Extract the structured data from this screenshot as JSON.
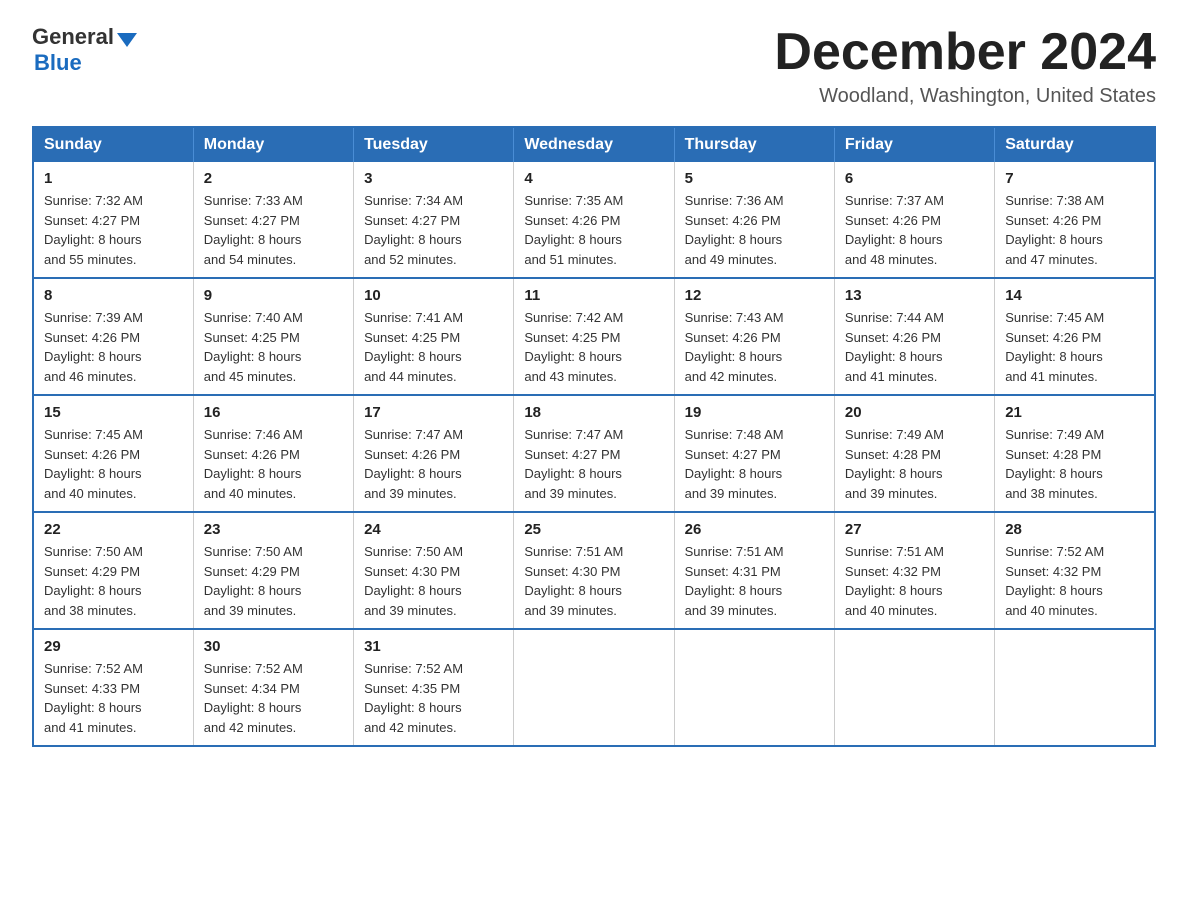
{
  "header": {
    "logo_general": "General",
    "logo_blue": "Blue",
    "title": "December 2024",
    "subtitle": "Woodland, Washington, United States"
  },
  "days_of_week": [
    "Sunday",
    "Monday",
    "Tuesday",
    "Wednesday",
    "Thursday",
    "Friday",
    "Saturday"
  ],
  "weeks": [
    [
      {
        "day": "1",
        "sunrise": "Sunrise: 7:32 AM",
        "sunset": "Sunset: 4:27 PM",
        "daylight": "Daylight: 8 hours",
        "daylight2": "and 55 minutes."
      },
      {
        "day": "2",
        "sunrise": "Sunrise: 7:33 AM",
        "sunset": "Sunset: 4:27 PM",
        "daylight": "Daylight: 8 hours",
        "daylight2": "and 54 minutes."
      },
      {
        "day": "3",
        "sunrise": "Sunrise: 7:34 AM",
        "sunset": "Sunset: 4:27 PM",
        "daylight": "Daylight: 8 hours",
        "daylight2": "and 52 minutes."
      },
      {
        "day": "4",
        "sunrise": "Sunrise: 7:35 AM",
        "sunset": "Sunset: 4:26 PM",
        "daylight": "Daylight: 8 hours",
        "daylight2": "and 51 minutes."
      },
      {
        "day": "5",
        "sunrise": "Sunrise: 7:36 AM",
        "sunset": "Sunset: 4:26 PM",
        "daylight": "Daylight: 8 hours",
        "daylight2": "and 49 minutes."
      },
      {
        "day": "6",
        "sunrise": "Sunrise: 7:37 AM",
        "sunset": "Sunset: 4:26 PM",
        "daylight": "Daylight: 8 hours",
        "daylight2": "and 48 minutes."
      },
      {
        "day": "7",
        "sunrise": "Sunrise: 7:38 AM",
        "sunset": "Sunset: 4:26 PM",
        "daylight": "Daylight: 8 hours",
        "daylight2": "and 47 minutes."
      }
    ],
    [
      {
        "day": "8",
        "sunrise": "Sunrise: 7:39 AM",
        "sunset": "Sunset: 4:26 PM",
        "daylight": "Daylight: 8 hours",
        "daylight2": "and 46 minutes."
      },
      {
        "day": "9",
        "sunrise": "Sunrise: 7:40 AM",
        "sunset": "Sunset: 4:25 PM",
        "daylight": "Daylight: 8 hours",
        "daylight2": "and 45 minutes."
      },
      {
        "day": "10",
        "sunrise": "Sunrise: 7:41 AM",
        "sunset": "Sunset: 4:25 PM",
        "daylight": "Daylight: 8 hours",
        "daylight2": "and 44 minutes."
      },
      {
        "day": "11",
        "sunrise": "Sunrise: 7:42 AM",
        "sunset": "Sunset: 4:25 PM",
        "daylight": "Daylight: 8 hours",
        "daylight2": "and 43 minutes."
      },
      {
        "day": "12",
        "sunrise": "Sunrise: 7:43 AM",
        "sunset": "Sunset: 4:26 PM",
        "daylight": "Daylight: 8 hours",
        "daylight2": "and 42 minutes."
      },
      {
        "day": "13",
        "sunrise": "Sunrise: 7:44 AM",
        "sunset": "Sunset: 4:26 PM",
        "daylight": "Daylight: 8 hours",
        "daylight2": "and 41 minutes."
      },
      {
        "day": "14",
        "sunrise": "Sunrise: 7:45 AM",
        "sunset": "Sunset: 4:26 PM",
        "daylight": "Daylight: 8 hours",
        "daylight2": "and 41 minutes."
      }
    ],
    [
      {
        "day": "15",
        "sunrise": "Sunrise: 7:45 AM",
        "sunset": "Sunset: 4:26 PM",
        "daylight": "Daylight: 8 hours",
        "daylight2": "and 40 minutes."
      },
      {
        "day": "16",
        "sunrise": "Sunrise: 7:46 AM",
        "sunset": "Sunset: 4:26 PM",
        "daylight": "Daylight: 8 hours",
        "daylight2": "and 40 minutes."
      },
      {
        "day": "17",
        "sunrise": "Sunrise: 7:47 AM",
        "sunset": "Sunset: 4:26 PM",
        "daylight": "Daylight: 8 hours",
        "daylight2": "and 39 minutes."
      },
      {
        "day": "18",
        "sunrise": "Sunrise: 7:47 AM",
        "sunset": "Sunset: 4:27 PM",
        "daylight": "Daylight: 8 hours",
        "daylight2": "and 39 minutes."
      },
      {
        "day": "19",
        "sunrise": "Sunrise: 7:48 AM",
        "sunset": "Sunset: 4:27 PM",
        "daylight": "Daylight: 8 hours",
        "daylight2": "and 39 minutes."
      },
      {
        "day": "20",
        "sunrise": "Sunrise: 7:49 AM",
        "sunset": "Sunset: 4:28 PM",
        "daylight": "Daylight: 8 hours",
        "daylight2": "and 39 minutes."
      },
      {
        "day": "21",
        "sunrise": "Sunrise: 7:49 AM",
        "sunset": "Sunset: 4:28 PM",
        "daylight": "Daylight: 8 hours",
        "daylight2": "and 38 minutes."
      }
    ],
    [
      {
        "day": "22",
        "sunrise": "Sunrise: 7:50 AM",
        "sunset": "Sunset: 4:29 PM",
        "daylight": "Daylight: 8 hours",
        "daylight2": "and 38 minutes."
      },
      {
        "day": "23",
        "sunrise": "Sunrise: 7:50 AM",
        "sunset": "Sunset: 4:29 PM",
        "daylight": "Daylight: 8 hours",
        "daylight2": "and 39 minutes."
      },
      {
        "day": "24",
        "sunrise": "Sunrise: 7:50 AM",
        "sunset": "Sunset: 4:30 PM",
        "daylight": "Daylight: 8 hours",
        "daylight2": "and 39 minutes."
      },
      {
        "day": "25",
        "sunrise": "Sunrise: 7:51 AM",
        "sunset": "Sunset: 4:30 PM",
        "daylight": "Daylight: 8 hours",
        "daylight2": "and 39 minutes."
      },
      {
        "day": "26",
        "sunrise": "Sunrise: 7:51 AM",
        "sunset": "Sunset: 4:31 PM",
        "daylight": "Daylight: 8 hours",
        "daylight2": "and 39 minutes."
      },
      {
        "day": "27",
        "sunrise": "Sunrise: 7:51 AM",
        "sunset": "Sunset: 4:32 PM",
        "daylight": "Daylight: 8 hours",
        "daylight2": "and 40 minutes."
      },
      {
        "day": "28",
        "sunrise": "Sunrise: 7:52 AM",
        "sunset": "Sunset: 4:32 PM",
        "daylight": "Daylight: 8 hours",
        "daylight2": "and 40 minutes."
      }
    ],
    [
      {
        "day": "29",
        "sunrise": "Sunrise: 7:52 AM",
        "sunset": "Sunset: 4:33 PM",
        "daylight": "Daylight: 8 hours",
        "daylight2": "and 41 minutes."
      },
      {
        "day": "30",
        "sunrise": "Sunrise: 7:52 AM",
        "sunset": "Sunset: 4:34 PM",
        "daylight": "Daylight: 8 hours",
        "daylight2": "and 42 minutes."
      },
      {
        "day": "31",
        "sunrise": "Sunrise: 7:52 AM",
        "sunset": "Sunset: 4:35 PM",
        "daylight": "Daylight: 8 hours",
        "daylight2": "and 42 minutes."
      },
      {
        "day": "",
        "empty": true
      },
      {
        "day": "",
        "empty": true
      },
      {
        "day": "",
        "empty": true
      },
      {
        "day": "",
        "empty": true
      }
    ]
  ]
}
